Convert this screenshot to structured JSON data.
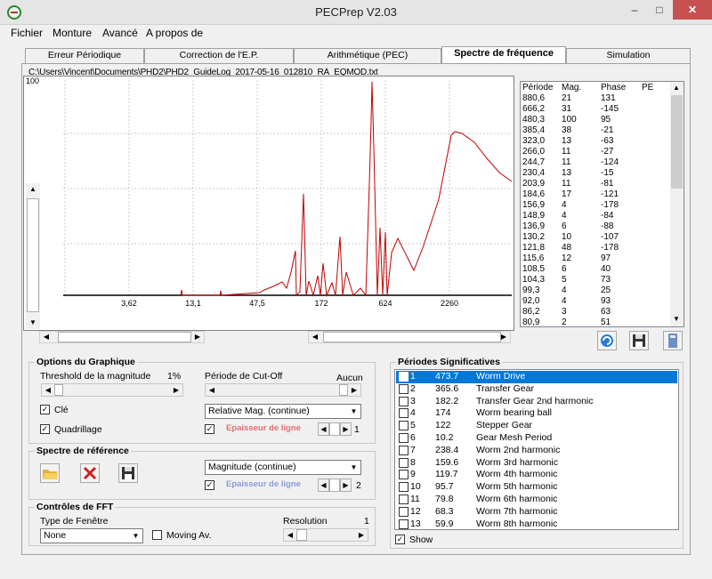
{
  "window": {
    "title": "PECPrep V2.03",
    "min_label": "–",
    "max_label": "□",
    "close_label": "✕"
  },
  "menu": [
    "Fichier",
    "Monture",
    "Avancé",
    "A propos de"
  ],
  "tabs": [
    "Erreur Périodique",
    "Correction de l'E.P.",
    "Arithmétique (PEC)",
    "Spectre de fréquence",
    "Simulation"
  ],
  "active_tab": 3,
  "file_path": "C:\\Users\\Vincent\\Documents\\PHD2\\PHD2_GuideLog_2017-05-16_012810_RA_EQMOD.txt",
  "chart_data": {
    "type": "line",
    "y_max_label": "100",
    "x_tick_labels": [
      "3,62",
      "13,1",
      "47,5",
      "172",
      "624",
      "2260"
    ],
    "grid": true,
    "line_color": "#c00000",
    "peaks": [
      {
        "period": "473,7",
        "magnitude": 100
      },
      {
        "period": "365,6",
        "magnitude": 38
      },
      {
        "period": "182,2",
        "magnitude": 48
      },
      {
        "period": "174",
        "magnitude": 17
      },
      {
        "period": "122",
        "magnitude": 8
      }
    ]
  },
  "table": {
    "headers": [
      "Période",
      "Mag.",
      "Phase",
      "PE"
    ],
    "rows": [
      [
        "880,6",
        "21",
        "131"
      ],
      [
        "666,2",
        "31",
        "-145"
      ],
      [
        "480,3",
        "100",
        "95"
      ],
      [
        "385,4",
        "38",
        "-21"
      ],
      [
        "323,0",
        "13",
        "-63"
      ],
      [
        "266,0",
        "11",
        "-27"
      ],
      [
        "244,7",
        "11",
        "-124"
      ],
      [
        "230,4",
        "13",
        "-15"
      ],
      [
        "203,9",
        "11",
        "-81"
      ],
      [
        "184,6",
        "17",
        "-121"
      ],
      [
        "156,9",
        "4",
        "-178"
      ],
      [
        "148,9",
        "4",
        "-84"
      ],
      [
        "136,9",
        "6",
        "-88"
      ],
      [
        "130,2",
        "10",
        "-107"
      ],
      [
        "121,8",
        "48",
        "-178"
      ],
      [
        "115,6",
        "12",
        "97"
      ],
      [
        "108,5",
        "6",
        "40"
      ],
      [
        "104,3",
        "5",
        "73"
      ],
      [
        "99,3",
        "4",
        "25"
      ],
      [
        "92,0",
        "4",
        "93"
      ],
      [
        "86,2",
        "3",
        "63"
      ],
      [
        "80,9",
        "2",
        "51"
      ]
    ]
  },
  "options": {
    "title": "Options du Graphique",
    "threshold_label": "Threshold de la magnitude",
    "threshold_value": "1%",
    "cutoff_label": "Période de Cut-Off",
    "cutoff_value": "Aucun",
    "cle_label": "Clé",
    "grid_label": "Quadrillage",
    "combo_value": "Relative Mag. (continue)",
    "thickness_label": "Epaisseur de ligne",
    "thickness_value": "1"
  },
  "reference": {
    "title": "Spectre de référence",
    "combo_value": "Magnitude (continue)",
    "thickness_label": "Epaisseur de ligne",
    "thickness_value": "2"
  },
  "fft": {
    "title": "Contrôles de FFT",
    "window_label": "Type de Fenêtre",
    "window_value": "None",
    "moving_label": "Moving Av.",
    "resolution_label": "Resolution",
    "resolution_value": "1"
  },
  "significant": {
    "title": "Périodes Significatives",
    "rows": [
      [
        "1",
        "473.7",
        "Worm Drive"
      ],
      [
        "2",
        "365.6",
        "Transfer Gear"
      ],
      [
        "3",
        "182.2",
        "Transfer Gear 2nd harmonic"
      ],
      [
        "4",
        "174",
        "Worm bearing ball"
      ],
      [
        "5",
        "122",
        "Stepper Gear"
      ],
      [
        "6",
        "10.2",
        "Gear Mesh Period"
      ],
      [
        "7",
        "238.4",
        "Worm 2nd harmonic"
      ],
      [
        "8",
        "159.6",
        "Worm 3rd harmonic"
      ],
      [
        "9",
        "119.7",
        "Worm 4th harmonic"
      ],
      [
        "10",
        "95.7",
        "Worm 5th harmonic"
      ],
      [
        "11",
        "79.8",
        "Worm 6th harmonic"
      ],
      [
        "12",
        "68.3",
        "Worm 7th harmonic"
      ],
      [
        "13",
        "59.9",
        "Worm 8th harmonic"
      ]
    ],
    "show_label": "Show"
  }
}
